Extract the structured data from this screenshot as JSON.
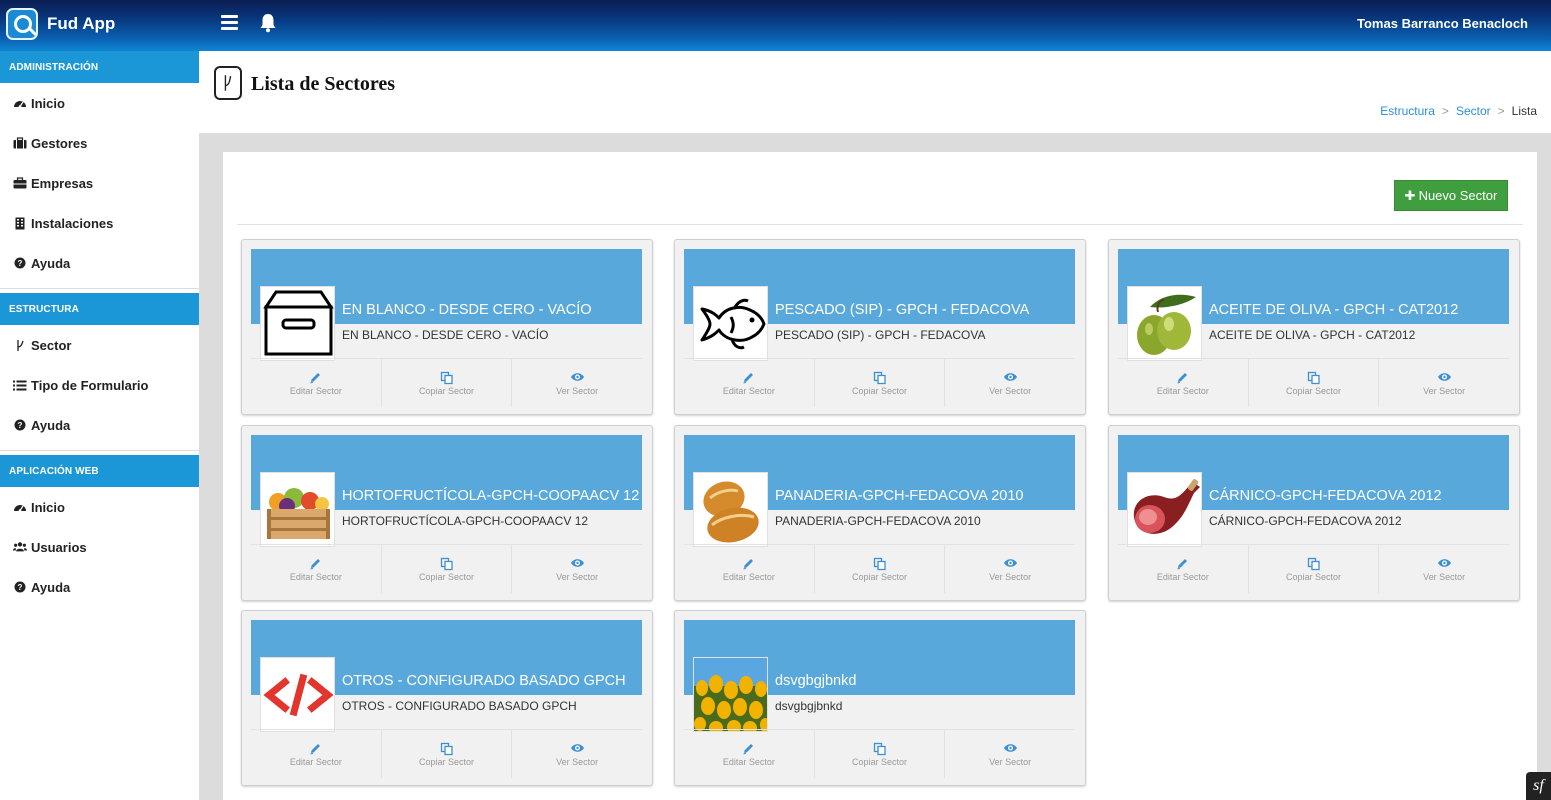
{
  "app": {
    "name": "Fud App",
    "user": "Tomas Barranco Benacloch"
  },
  "sidebar": {
    "sections": [
      {
        "title": "ADMINISTRACIÓN",
        "items": [
          {
            "label": "Inicio",
            "icon": "dashboard-icon"
          },
          {
            "label": "Gestores",
            "icon": "briefcase-icon"
          },
          {
            "label": "Empresas",
            "icon": "toolbox-icon"
          },
          {
            "label": "Instalaciones",
            "icon": "building-icon"
          },
          {
            "label": "Ayuda",
            "icon": "question-icon"
          }
        ]
      },
      {
        "title": "ESTRUCTURA",
        "items": [
          {
            "label": "Sector",
            "icon": "fork-icon"
          },
          {
            "label": "Tipo de Formulario",
            "icon": "list-icon"
          },
          {
            "label": "Ayuda",
            "icon": "question-icon"
          }
        ]
      },
      {
        "title": "APLICACIÓN WEB",
        "items": [
          {
            "label": "Inicio",
            "icon": "dashboard-icon"
          },
          {
            "label": "Usuarios",
            "icon": "users-icon"
          },
          {
            "label": "Ayuda",
            "icon": "question-icon"
          }
        ]
      }
    ]
  },
  "page": {
    "title": "Lista de Sectores",
    "breadcrumb": [
      "Estructura",
      "Sector",
      "Lista"
    ],
    "new_button": "Nuevo Sector"
  },
  "actions": {
    "edit": "Editar Sector",
    "copy": "Copiar Sector",
    "view": "Ver Sector"
  },
  "sectors": [
    {
      "title": "EN BLANCO - DESDE CERO - VACÍO",
      "subtitle": "EN BLANCO - DESDE CERO - VACÍO",
      "image": "box-image"
    },
    {
      "title": "PESCADO (SIP) - GPCH - FEDACOVA",
      "subtitle": "PESCADO (SIP) - GPCH - FEDACOVA",
      "image": "fish-image"
    },
    {
      "title": "ACEITE DE OLIVA - GPCH - CAT2012",
      "subtitle": "ACEITE DE OLIVA - GPCH - CAT2012",
      "image": "olives-image"
    },
    {
      "title": "HORTOFRUCTÍCOLA-GPCH-COOPAACV 12",
      "subtitle": "HORTOFRUCTÍCOLA-GPCH-COOPAACV 12",
      "image": "fruit-crate-image"
    },
    {
      "title": "PANADERIA-GPCH-FEDACOVA 2010",
      "subtitle": "PANADERIA-GPCH-FEDACOVA 2010",
      "image": "bread-image"
    },
    {
      "title": "CÁRNICO-GPCH-FEDACOVA 2012",
      "subtitle": "CÁRNICO-GPCH-FEDACOVA 2012",
      "image": "ham-image"
    },
    {
      "title": "OTROS - CONFIGURADO BASADO GPCH",
      "subtitle": "OTROS - CONFIGURADO BASADO GPCH",
      "image": "code-image"
    },
    {
      "title": "dsvgbgjbnkd",
      "subtitle": "dsvgbgjbnkd",
      "image": "tulips-image"
    }
  ],
  "colors": {
    "topbar": "#0a5fb0",
    "section": "#1b97d8",
    "card_band": "#58a8db",
    "button_green": "#3f9f3f",
    "link": "#2a8fd1"
  }
}
